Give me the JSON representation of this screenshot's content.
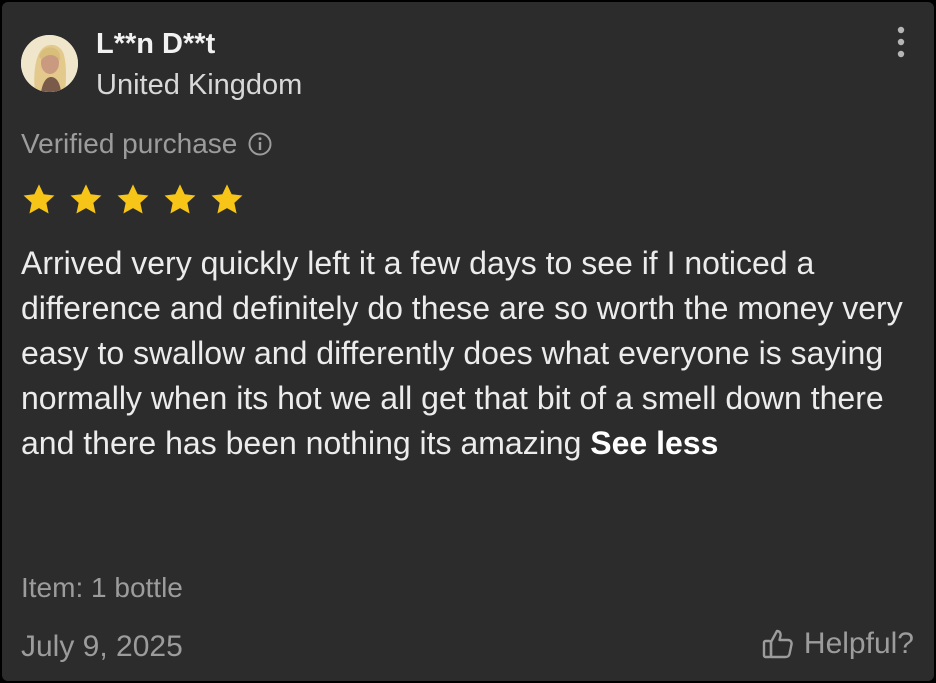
{
  "review": {
    "reviewer": {
      "name": "L**n D**t",
      "country": "United Kingdom"
    },
    "verified_label": "Verified purchase",
    "rating": 5,
    "rating_max": 5,
    "text": "Arrived very quickly left it a few days to see if I noticed a difference and definitely do these are so worth the money very easy to swallow and differently does what everyone is saying normally when its hot we all get that bit of a smell down there and there has been nothing its amazing",
    "see_less_label": "See less",
    "item": "Item: 1 bottle",
    "date": "July 9, 2025",
    "helpful_label": "Helpful?"
  },
  "icons": {
    "more": "more-vertical-icon",
    "info": "info-icon",
    "star": "star-icon",
    "thumb": "thumbs-up-icon"
  },
  "colors": {
    "card_background": "#2c2c2c",
    "star": "#f7c518",
    "primary_text": "#ececec",
    "secondary_text": "#9c9c9c"
  }
}
